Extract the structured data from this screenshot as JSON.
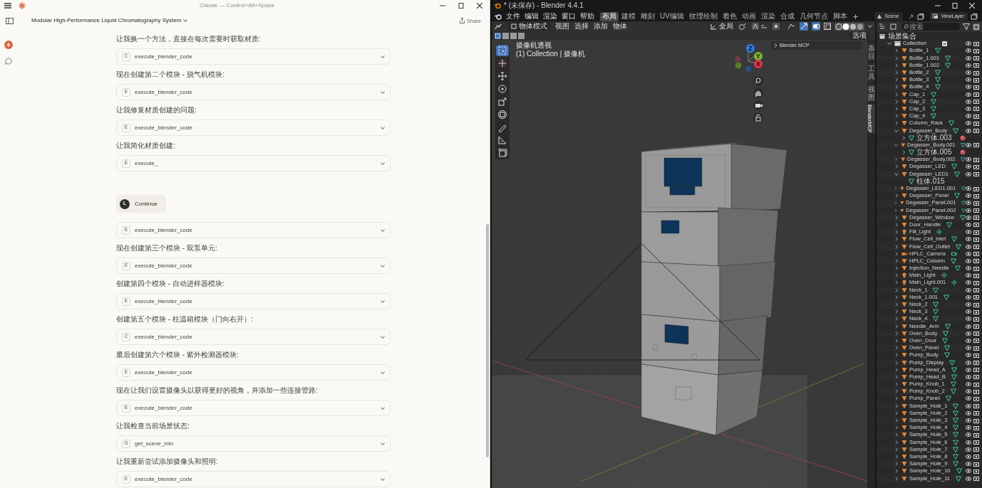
{
  "claude": {
    "app_title": "Claude — Control+Alt+Space",
    "conversation_title": "Modular High-Performance Liquid Chromatography System",
    "share_label": "Share",
    "messages": [
      {
        "kind": "text",
        "text": "让我换一个方法，直接在每次需要时获取材质:"
      },
      {
        "kind": "tool",
        "badge": "C",
        "name": "execute_blender_code"
      },
      {
        "kind": "text",
        "text": "现在创建第二个模块 - 脱气机模块:"
      },
      {
        "kind": "tool",
        "badge": "E",
        "name": "execute_blender_code"
      },
      {
        "kind": "text",
        "text": "让我修复材质创建的问题:"
      },
      {
        "kind": "tool",
        "badge": "E",
        "name": "execute_blender_code"
      },
      {
        "kind": "text",
        "text": "让我简化材质创建:"
      },
      {
        "kind": "tool",
        "badge": "E",
        "name": "execute_"
      },
      {
        "kind": "user",
        "avatar": "L",
        "text": "Continue"
      },
      {
        "kind": "tool",
        "badge": "E",
        "name": "execute_blender_code"
      },
      {
        "kind": "text",
        "text": "现在创建第三个模块 - 双泵单元:"
      },
      {
        "kind": "tool",
        "badge": "E",
        "name": "execute_blender_code"
      },
      {
        "kind": "text",
        "text": "创建第四个模块 - 自动进样器模块:"
      },
      {
        "kind": "tool",
        "badge": "E",
        "name": "execute_blender_code"
      },
      {
        "kind": "text",
        "text": "创建第五个模块 - 柱温箱模块（门向右开）:"
      },
      {
        "kind": "tool",
        "badge": "C",
        "name": "execute_blender_code"
      },
      {
        "kind": "text",
        "text": "最后创建第六个模块 - 紫外检测器模块:"
      },
      {
        "kind": "tool",
        "badge": "E",
        "name": "execute_blender_code"
      },
      {
        "kind": "text",
        "text": "现在让我们设置摄像头以获得更好的视角，并添加一些连接管路:"
      },
      {
        "kind": "tool",
        "badge": "E",
        "name": "execute_blender_code"
      },
      {
        "kind": "text",
        "text": "让我检查当前场景状态:"
      },
      {
        "kind": "tool",
        "badge": "G",
        "name": "get_scene_info"
      },
      {
        "kind": "text",
        "text": "让我重新尝试添加摄像头和照明:"
      },
      {
        "kind": "tool",
        "badge": "E",
        "name": "execute_blender_code"
      }
    ]
  },
  "blender": {
    "title": "* (未保存) - Blender 4.4.1",
    "menu": [
      "文件",
      "编辑",
      "渲染",
      "窗口",
      "帮助"
    ],
    "workspaces": [
      {
        "label": "布局",
        "selected": true
      },
      {
        "label": "建模",
        "selected": false
      },
      {
        "label": "雕刻",
        "selected": false
      },
      {
        "label": "UV编辑",
        "selected": false
      },
      {
        "label": "纹理绘制",
        "selected": false
      },
      {
        "label": "着色",
        "selected": false
      },
      {
        "label": "动画",
        "selected": false
      },
      {
        "label": "渲染",
        "selected": false
      },
      {
        "label": "合成",
        "selected": false
      },
      {
        "label": "几何节点",
        "selected": false
      },
      {
        "label": "脚本",
        "selected": false
      }
    ],
    "scene": "Scene",
    "view_layer": "ViewLayer",
    "header": {
      "mode": "物体模式",
      "menus": [
        "视图",
        "选择",
        "添加",
        "物体"
      ],
      "orientation": "全局",
      "options": "选项"
    },
    "viewport": {
      "view_name": "摄像机透视",
      "context": "(1) Collection | 摄像机",
      "panel_title": "Blender MCP",
      "gizmo_axes": [
        "Z",
        "Y",
        "X"
      ],
      "tools": [
        {
          "kind": "select",
          "selected": true
        },
        {
          "kind": "cursor",
          "selected": false
        },
        {
          "kind": "move",
          "selected": false
        },
        {
          "kind": "rotate",
          "selected": false
        },
        {
          "kind": "scale",
          "selected": false
        },
        {
          "kind": "transform",
          "selected": false
        },
        {
          "kind": "annotate",
          "selected": false
        },
        {
          "kind": "measure",
          "selected": false
        },
        {
          "kind": "add_cube",
          "selected": false
        }
      ]
    },
    "side_tabs": [
      {
        "label": "条目",
        "selected": false
      },
      {
        "label": "工具",
        "selected": false
      },
      {
        "label": "视图",
        "selected": false
      },
      {
        "label": "BlenderMCP",
        "selected": true
      }
    ],
    "outliner": {
      "search_placeholder": "搜索",
      "root": "场景集合",
      "collection": {
        "name": "Collection",
        "checked": true,
        "expanded": true
      },
      "objects": [
        {
          "name": "Bottle_1",
          "kind": "mesh",
          "expanded": false
        },
        {
          "name": "Bottle_1.001",
          "kind": "mesh",
          "expanded": false
        },
        {
          "name": "Bottle_1.002",
          "kind": "mesh",
          "expanded": false
        },
        {
          "name": "Bottle_2",
          "kind": "mesh",
          "expanded": false
        },
        {
          "name": "Bottle_3",
          "kind": "mesh",
          "expanded": false
        },
        {
          "name": "Bottle_4",
          "kind": "mesh",
          "expanded": false
        },
        {
          "name": "Cap_1",
          "kind": "mesh",
          "expanded": false
        },
        {
          "name": "Cap_2",
          "kind": "mesh",
          "expanded": false
        },
        {
          "name": "Cap_3",
          "kind": "mesh",
          "expanded": false
        },
        {
          "name": "Cap_4",
          "kind": "mesh",
          "expanded": false
        },
        {
          "name": "Column_Rack",
          "kind": "mesh",
          "expanded": false
        },
        {
          "name": "Degasser_Body",
          "kind": "mesh",
          "expanded": true,
          "children": [
            {
              "name": "立方体.003",
              "kind": "mesh_data",
              "has_material": true
            }
          ]
        },
        {
          "name": "Degasser_Body.001",
          "kind": "mesh",
          "expanded": true,
          "children": [
            {
              "name": "立方体.005",
              "kind": "mesh_data",
              "has_material": true
            }
          ]
        },
        {
          "name": "Degasser_Body.002",
          "kind": "mesh",
          "expanded": false
        },
        {
          "name": "Degasser_LED",
          "kind": "mesh",
          "expanded": false
        },
        {
          "name": "Degasser_LED1",
          "kind": "mesh",
          "expanded": true,
          "children": [
            {
              "name": "柱体.015",
              "kind": "mesh_data",
              "has_material": false
            }
          ]
        },
        {
          "name": "Degasser_LED1.001",
          "kind": "mesh",
          "expanded": false
        },
        {
          "name": "Degasser_Panel",
          "kind": "mesh",
          "expanded": false
        },
        {
          "name": "Degasser_Panel.001",
          "kind": "mesh",
          "expanded": false
        },
        {
          "name": "Degasser_Panel.002",
          "kind": "mesh",
          "expanded": false
        },
        {
          "name": "Degasser_Window",
          "kind": "mesh",
          "expanded": false
        },
        {
          "name": "Door_Handle",
          "kind": "mesh",
          "expanded": false
        },
        {
          "name": "Fill_Light",
          "kind": "light",
          "expanded": false
        },
        {
          "name": "Flow_Cell_Inlet",
          "kind": "mesh",
          "expanded": false
        },
        {
          "name": "Flow_Cell_Outlet",
          "kind": "mesh",
          "expanded": false
        },
        {
          "name": "HPLC_Camera",
          "kind": "camera",
          "expanded": false
        },
        {
          "name": "HPLC_Column",
          "kind": "mesh",
          "expanded": false
        },
        {
          "name": "Injection_Needle",
          "kind": "mesh",
          "expanded": false
        },
        {
          "name": "Main_Light",
          "kind": "light",
          "expanded": false
        },
        {
          "name": "Main_Light.001",
          "kind": "light",
          "expanded": false
        },
        {
          "name": "Neck_1",
          "kind": "mesh",
          "expanded": false
        },
        {
          "name": "Neck_1.001",
          "kind": "mesh",
          "expanded": false
        },
        {
          "name": "Neck_2",
          "kind": "mesh",
          "expanded": false
        },
        {
          "name": "Neck_3",
          "kind": "mesh",
          "expanded": false
        },
        {
          "name": "Neck_4",
          "kind": "mesh",
          "expanded": false
        },
        {
          "name": "Needle_Arm",
          "kind": "mesh",
          "expanded": false
        },
        {
          "name": "Oven_Body",
          "kind": "mesh",
          "expanded": false
        },
        {
          "name": "Oven_Door",
          "kind": "mesh",
          "expanded": false
        },
        {
          "name": "Oven_Panel",
          "kind": "mesh",
          "expanded": false
        },
        {
          "name": "Pump_Body",
          "kind": "mesh",
          "expanded": false
        },
        {
          "name": "Pump_Display",
          "kind": "mesh",
          "expanded": false
        },
        {
          "name": "Pump_Head_A",
          "kind": "mesh",
          "expanded": false
        },
        {
          "name": "Pump_Head_B",
          "kind": "mesh",
          "expanded": false
        },
        {
          "name": "Pump_Knob_1",
          "kind": "mesh",
          "expanded": false
        },
        {
          "name": "Pump_Knob_2",
          "kind": "mesh",
          "expanded": false
        },
        {
          "name": "Pump_Panel",
          "kind": "mesh",
          "expanded": false
        },
        {
          "name": "Sample_Hole_1",
          "kind": "mesh",
          "expanded": false
        },
        {
          "name": "Sample_Hole_2",
          "kind": "mesh",
          "expanded": false
        },
        {
          "name": "Sample_Hole_3",
          "kind": "mesh",
          "expanded": false
        },
        {
          "name": "Sample_Hole_4",
          "kind": "mesh",
          "expanded": false
        },
        {
          "name": "Sample_Hole_5",
          "kind": "mesh",
          "expanded": false
        },
        {
          "name": "Sample_Hole_6",
          "kind": "mesh",
          "expanded": false
        },
        {
          "name": "Sample_Hole_7",
          "kind": "mesh",
          "expanded": false
        },
        {
          "name": "Sample_Hole_8",
          "kind": "mesh",
          "expanded": false
        },
        {
          "name": "Sample_Hole_9",
          "kind": "mesh",
          "expanded": false
        },
        {
          "name": "Sample_Hole_10",
          "kind": "mesh",
          "expanded": false
        },
        {
          "name": "Sample_Hole_11",
          "kind": "mesh",
          "expanded": false
        }
      ]
    }
  }
}
